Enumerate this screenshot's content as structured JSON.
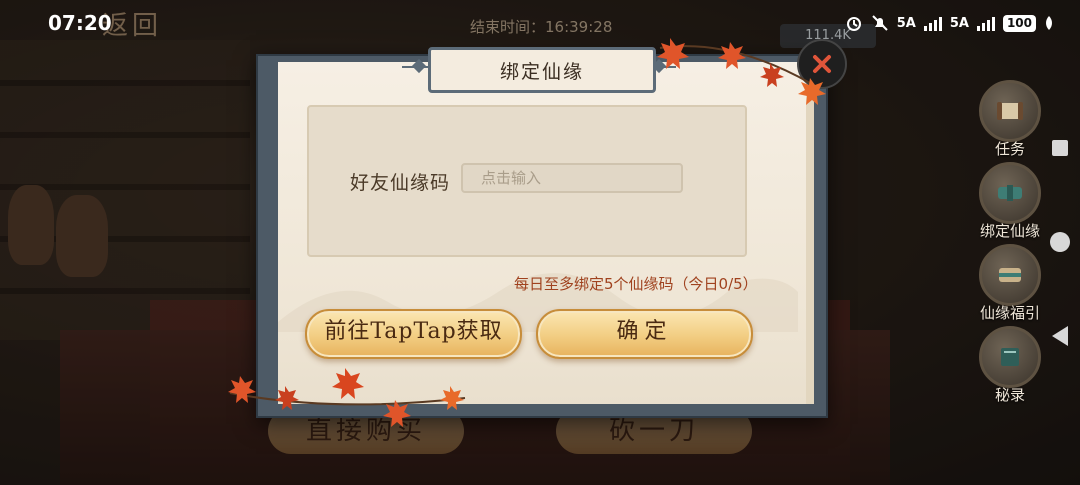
{
  "status_bar": {
    "time": "07:20",
    "network_1": "5A",
    "network_2": "5A",
    "battery": "100"
  },
  "hud": {
    "back_label": "返回",
    "end_time": "结束时间：16:39:28",
    "currency": "111.4K"
  },
  "side_menu": {
    "items": [
      {
        "label": "任务",
        "icon": "scroll-icon"
      },
      {
        "label": "绑定仙缘",
        "icon": "bind-scroll-icon"
      },
      {
        "label": "仙缘福引",
        "icon": "fortune-scroll-icon"
      },
      {
        "label": "秘录",
        "icon": "secret-book-icon"
      }
    ]
  },
  "background_buttons": {
    "buy_direct": "直接购买",
    "cut_once": "砍一刀"
  },
  "modal": {
    "title": "绑定仙缘",
    "field_label": "好友仙缘码",
    "input_placeholder": "点击输入",
    "input_value": "",
    "limit_text": "每日至多绑定5个仙缘码（今日0/5）",
    "btn_taptap": "前往TapTap获取",
    "btn_confirm": "确定"
  },
  "colors": {
    "frame": "#4d5a66",
    "paper": "#f6efe4",
    "gold_button": "#f2cd82",
    "limit_text": "#a0421f",
    "leaf": "#e0552a"
  }
}
